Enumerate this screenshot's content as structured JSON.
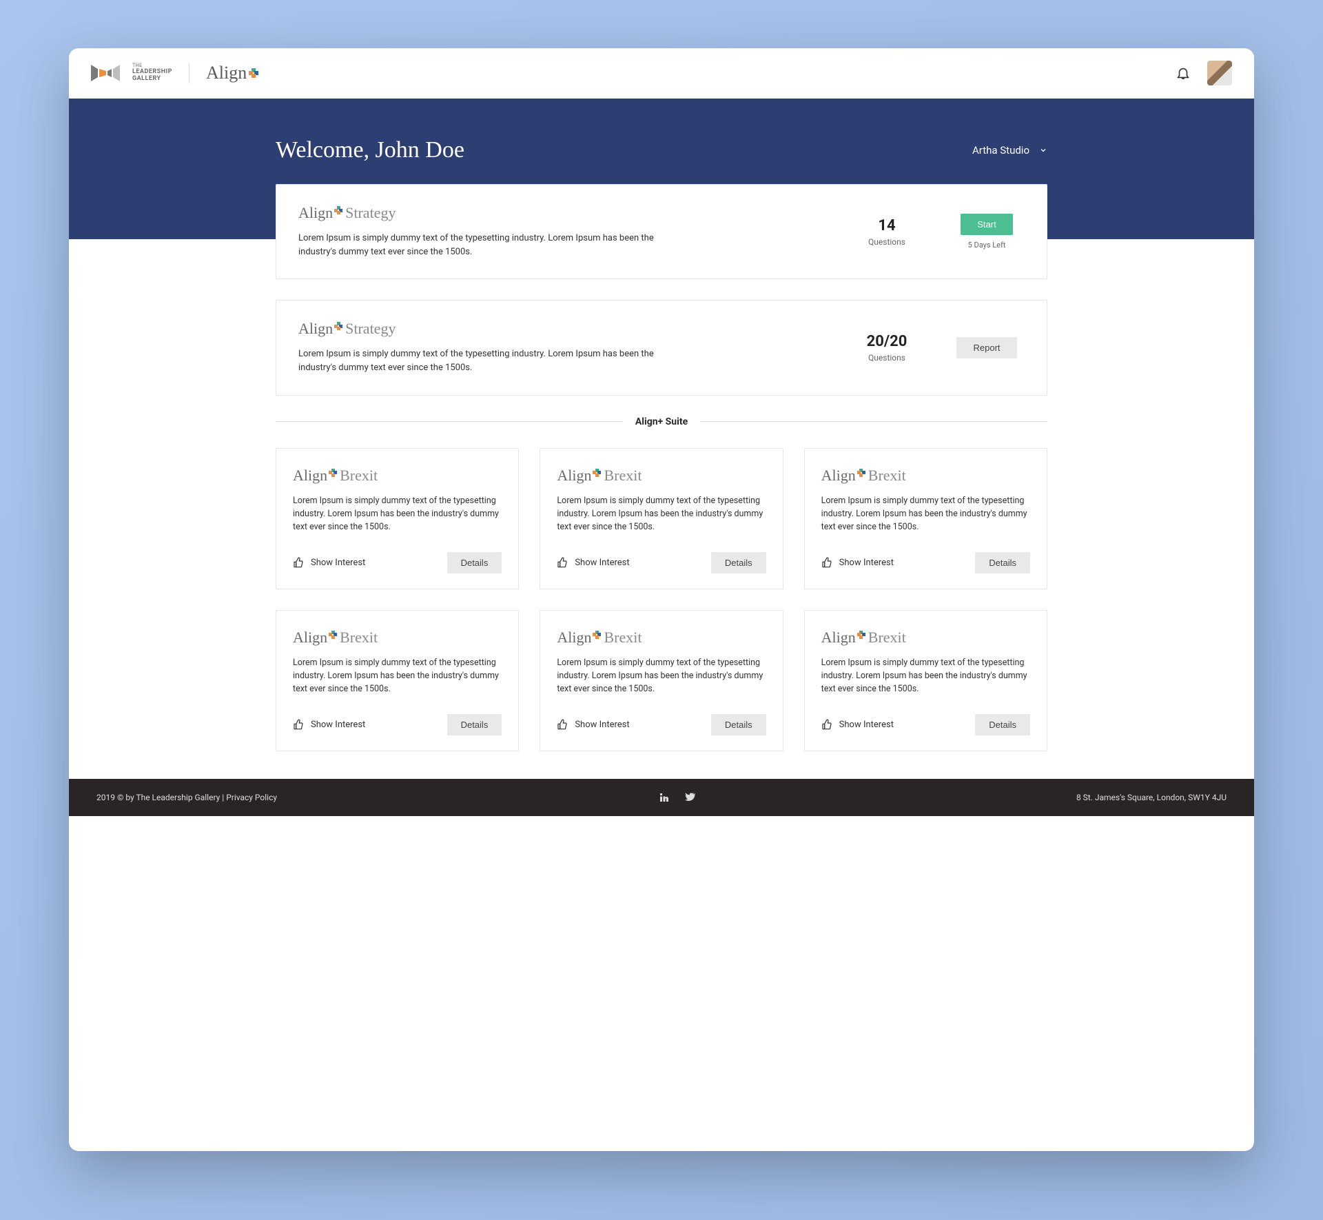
{
  "header": {
    "tlg_logo": {
      "line1": "THE",
      "line2": "LEADERSHIP",
      "line3": "GALLERY"
    },
    "app_name": "Align"
  },
  "hero": {
    "welcome": "Welcome, John Doe",
    "studio": "Artha Studio"
  },
  "activities": [
    {
      "title_prefix": "Align",
      "title_suffix": "Strategy",
      "desc": "Lorem Ipsum is simply dummy text of the typesetting industry. Lorem Ipsum has been the industry's dummy text ever since the 1500s.",
      "count": "14",
      "count_label": "Questions",
      "action": "Start",
      "sub": "5 Days Left"
    },
    {
      "title_prefix": "Align",
      "title_suffix": "Strategy",
      "desc": "Lorem Ipsum is simply dummy text of the typesetting industry. Lorem Ipsum has been the industry's dummy text ever since the 1500s.",
      "count": "20/20",
      "count_label": "Questions",
      "action": "Report",
      "sub": ""
    }
  ],
  "suite_title": "Align+ Suite",
  "suite": [
    {
      "title_prefix": "Align",
      "title_suffix": "Brexit",
      "desc": "Lorem Ipsum is simply dummy text of the typesetting industry. Lorem Ipsum has been the industry's dummy text ever since the 1500s.",
      "interest": "Show Interest",
      "details": "Details"
    },
    {
      "title_prefix": "Align",
      "title_suffix": "Brexit",
      "desc": "Lorem Ipsum is simply dummy text of the typesetting industry. Lorem Ipsum has been the industry's dummy text ever since the 1500s.",
      "interest": "Show Interest",
      "details": "Details"
    },
    {
      "title_prefix": "Align",
      "title_suffix": "Brexit",
      "desc": "Lorem Ipsum is simply dummy text of the typesetting industry. Lorem Ipsum has been the industry's dummy text ever since the 1500s.",
      "interest": "Show Interest",
      "details": "Details"
    },
    {
      "title_prefix": "Align",
      "title_suffix": "Brexit",
      "desc": "Lorem Ipsum is simply dummy text of the typesetting industry. Lorem Ipsum has been the industry's dummy text ever since the 1500s.",
      "interest": "Show Interest",
      "details": "Details"
    },
    {
      "title_prefix": "Align",
      "title_suffix": "Brexit",
      "desc": "Lorem Ipsum is simply dummy text of the typesetting industry. Lorem Ipsum has been the industry's dummy text ever since the 1500s.",
      "interest": "Show Interest",
      "details": "Details"
    },
    {
      "title_prefix": "Align",
      "title_suffix": "Brexit",
      "desc": "Lorem Ipsum is simply dummy text of the typesetting industry. Lorem Ipsum has been the industry's dummy text ever since the 1500s.",
      "interest": "Show Interest",
      "details": "Details"
    }
  ],
  "footer": {
    "copyright": "2019 © by The Leadership Gallery",
    "sep": " | ",
    "privacy": "Privacy Policy",
    "address": "8 St. James's Square, London, SW1Y 4JU"
  }
}
